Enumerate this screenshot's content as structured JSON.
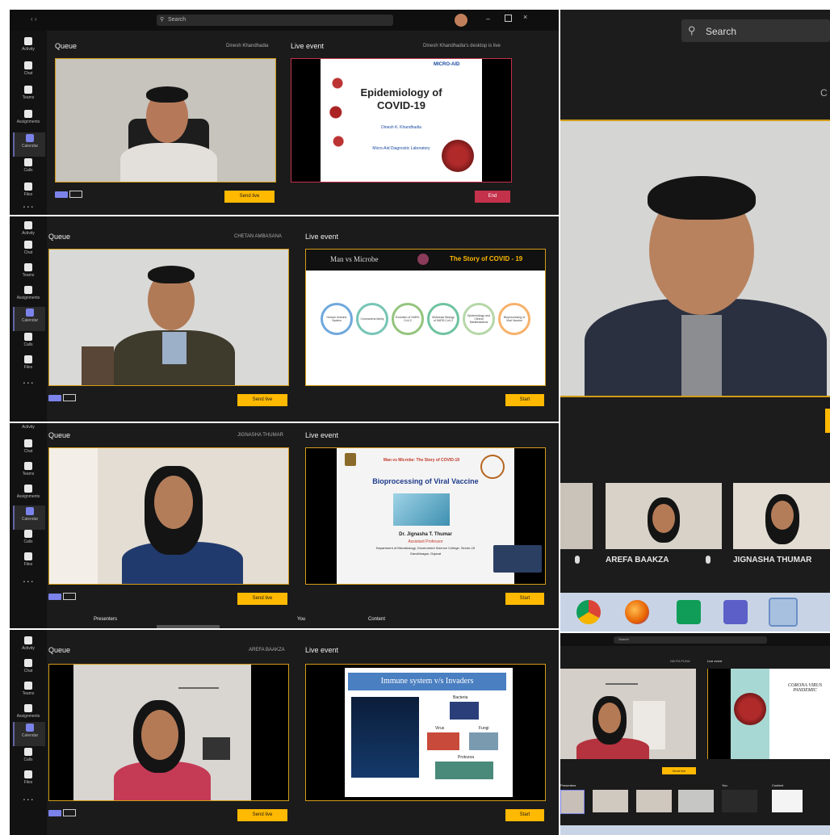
{
  "search": {
    "placeholder": "Search",
    "label": "Search"
  },
  "rail": [
    "Activity",
    "Chat",
    "Teams",
    "Assignments",
    "Calendar",
    "Calls",
    "Files"
  ],
  "rail_more": "...",
  "panels": [
    {
      "queue": "Queue",
      "presenter": "Dinesh Khandhadia",
      "live_title": "Live event",
      "live_status": "Dinesh Khandhadia's desktop is live",
      "send_button": "Send live",
      "action_button": "End",
      "slide": {
        "title": "Epidemiology of COVID-19",
        "author": "Dinesh K. Khandhadia",
        "org": "Micro-Aid Diagnostic Laboratory",
        "badge": "MICRO-AID"
      }
    },
    {
      "queue": "Queue",
      "presenter": "CHETAN AMBASANA",
      "live_title": "Live event",
      "send_button": "Send live",
      "action_button": "Start",
      "slide": {
        "left": "Man vs Microbe",
        "right": "The Story of COVID - 19",
        "steps": [
          "Human Immune System",
          "Coronavirus family",
          "Evolution of SARS-CoV-2",
          "Molecular Biology of SARS-CoV-2",
          "Epidemiology and Clinical Manifestations",
          "Bioprocessing of Viral Vaccine"
        ]
      }
    },
    {
      "queue": "Queue",
      "presenter": "JIGNASHA THUMAR",
      "live_title": "Live event",
      "send_button": "Send live",
      "action_button": "Start",
      "tabs": [
        "Presenters",
        "You",
        "Content"
      ],
      "slide": {
        "banner": "Man vs Microbe: The Story of COVID-19",
        "title": "Bioprocessing of Viral Vaccine",
        "author": "Dr. Jignasha T. Thumar",
        "role": "Assistant Professor",
        "dept": "Department of Microbiology, Government Science College, Sector-15",
        "city": "Gandhinagar, Gujarat"
      }
    },
    {
      "queue": "Queue",
      "presenter": "AREFA BAAKZA",
      "live_title": "Live event",
      "send_button": "Send live",
      "action_button": "Start",
      "slide": {
        "title": "Immune system v/s Invaders",
        "labels": [
          "Bacteria",
          "Virus",
          "Fungi",
          "Protozoa"
        ]
      }
    }
  ],
  "right_top": {
    "search": "Search",
    "tiles": [
      "AREFA BAAKZA",
      "JIGNASHA THUMAR"
    ]
  },
  "right_bottom": {
    "search": "Search",
    "presenter": "NIKITA PUNA",
    "live_title": "Live event",
    "send_button": "Send live",
    "slide": {
      "title": "CORONA VIRUS PANDEMIC"
    },
    "tabs": [
      "Presenters",
      "You",
      "Content"
    ]
  }
}
